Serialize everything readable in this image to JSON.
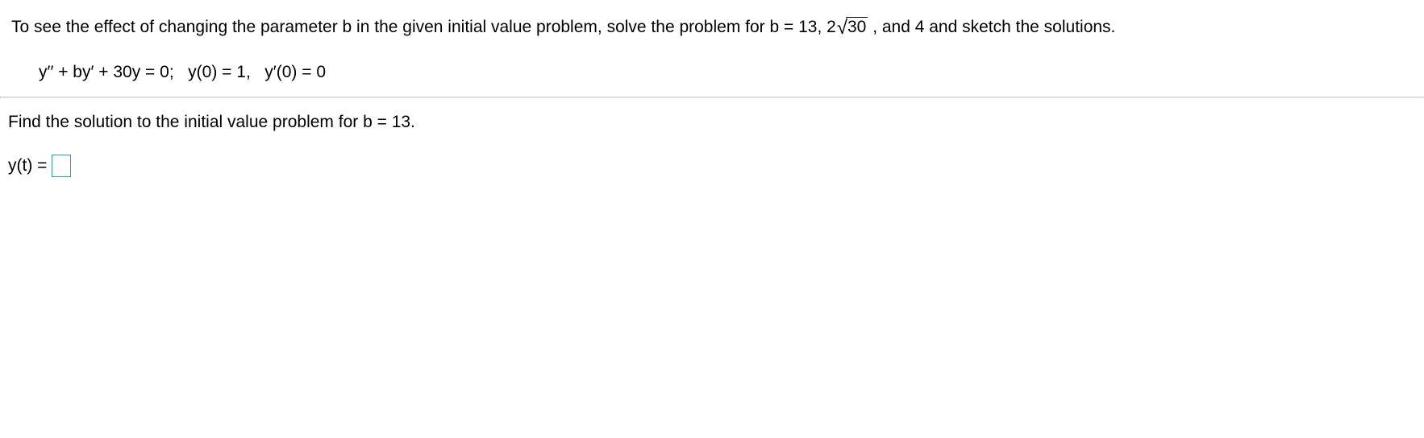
{
  "problem": {
    "intro_before_sqrt": "To see the effect of changing the parameter b in the given initial value problem, solve the problem for b = 13, 2",
    "sqrt_arg": "30",
    "intro_after_sqrt": " , and 4 and sketch the solutions.",
    "equation": "y′′ + by′ + 30y = 0;   y(0) = 1,   y′(0) = 0"
  },
  "question": {
    "text": "Find the solution to the initial value problem for b = 13."
  },
  "answer": {
    "label": "y(t) ="
  }
}
